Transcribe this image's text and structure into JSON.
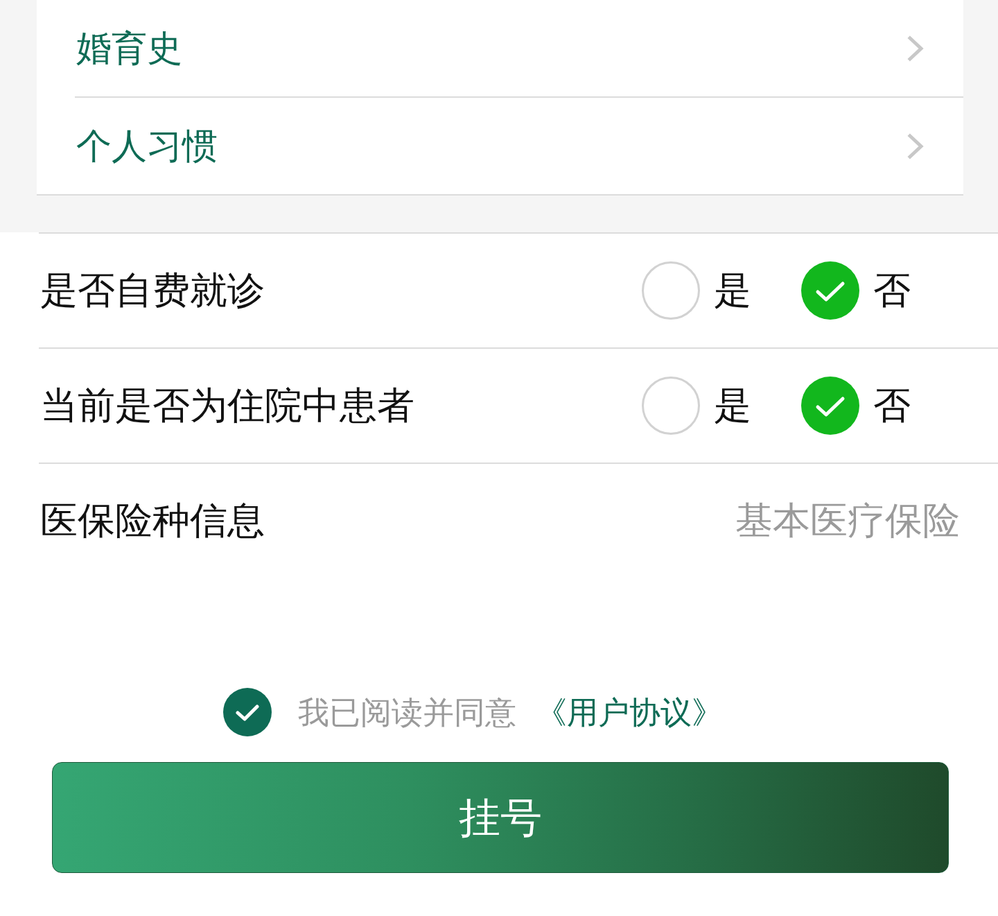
{
  "history_items": [
    {
      "label": "婚育史"
    },
    {
      "label": "个人习惯"
    }
  ],
  "questions": [
    {
      "kind": "radio",
      "label": "是否自费就诊",
      "options": [
        {
          "label": "是",
          "selected": false
        },
        {
          "label": "否",
          "selected": true
        }
      ]
    },
    {
      "kind": "radio",
      "label": "当前是否为住院中患者",
      "options": [
        {
          "label": "是",
          "selected": false
        },
        {
          "label": "否",
          "selected": true
        }
      ]
    },
    {
      "kind": "value",
      "label": "医保险种信息",
      "value": "基本医疗保险"
    }
  ],
  "agreement": {
    "checked": true,
    "text": "我已阅读并同意",
    "link": "《用户协议》"
  },
  "submit_button": {
    "label": "挂号"
  }
}
